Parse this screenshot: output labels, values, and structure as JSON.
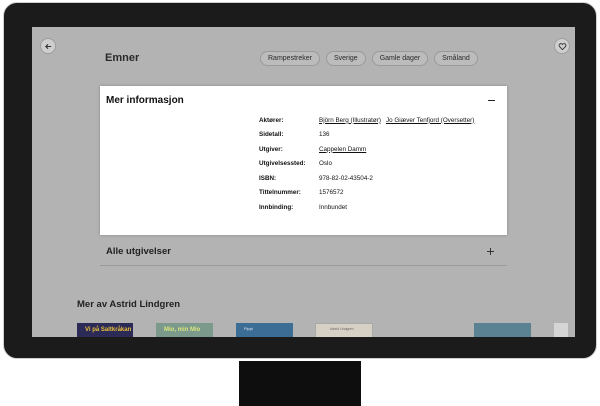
{
  "header": {
    "topics_title": "Emner",
    "topics": [
      "Rampestreker",
      "Sverige",
      "Gamle dager",
      "Småland"
    ]
  },
  "icons": {
    "back": "arrow-left-icon",
    "favorite": "heart-icon",
    "collapse": "minus-icon",
    "expand": "plus-icon"
  },
  "info_panel": {
    "title": "Mer informasjon",
    "rows": [
      {
        "key": "Aktører:",
        "links": [
          "Björn Berg (Illustratør)",
          "Jo Giæver Tenfjord (Oversetter)"
        ]
      },
      {
        "key": "Sidetall:",
        "value": "136"
      },
      {
        "key": "Utgiver:",
        "links": [
          "Cappelen Damm"
        ]
      },
      {
        "key": "Utgivelsessted:",
        "value": "Oslo"
      },
      {
        "key": "ISBN:",
        "value": "978-82-02-43504-2"
      },
      {
        "key": "Tittelnummer:",
        "value": "1576572"
      },
      {
        "key": "Innbinding:",
        "value": "Innbundet"
      }
    ]
  },
  "releases": {
    "title": "Alle utgivelser"
  },
  "more_by": {
    "title": "Mer av Astrid Lindgren",
    "covers": [
      "Vi på Saltkråkan",
      "Mio, min Mio",
      "Pippi",
      "Astrid Lindgren"
    ]
  },
  "colors": {
    "overlay": "#b3b3b3",
    "panel": "#ffffff",
    "bezel": "#1b1b1b"
  }
}
